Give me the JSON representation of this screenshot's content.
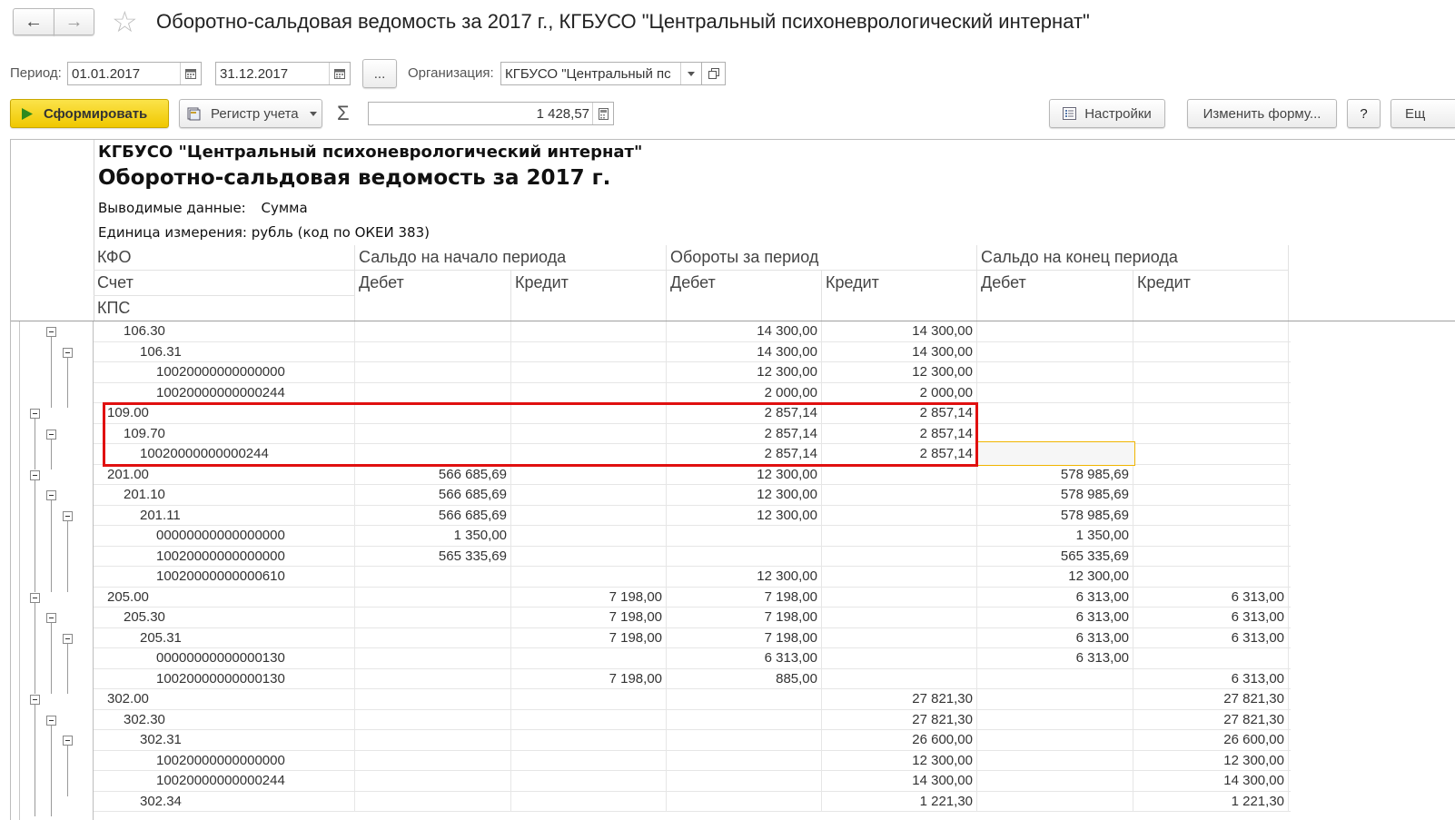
{
  "window": {
    "title": "Оборотно-сальдовая ведомость за 2017 г., КГБУСО \"Центральный психоневрологический интернат\""
  },
  "filters": {
    "period_label": "Период:",
    "date_from": "01.01.2017",
    "date_to": "31.12.2017",
    "more_label": "...",
    "org_label": "Организация:",
    "org_value": "КГБУСО \"Центральный пс"
  },
  "toolbar": {
    "generate_label": "Сформировать",
    "register_label": "Регистр учета",
    "sum_value": "1 428,57",
    "settings_label": "Настройки",
    "change_form_label": "Изменить форму...",
    "help_label": "?",
    "more_label": "Ещ"
  },
  "report": {
    "org_title": "КГБУСО \"Центральный психоневрологический интернат\"",
    "title": "Оборотно-сальдовая ведомость за 2017 г.",
    "output_label": "Выводимые данные:",
    "output_value": "Сумма",
    "unit_line": "Единица измерения: рубль (код по ОКЕИ 383)",
    "col_kfo": "КФО",
    "col_account": "Счет",
    "col_kps": "КПС",
    "group_start": "Сальдо на начало периода",
    "group_turnover": "Обороты за период",
    "group_end": "Сальдо на конец периода",
    "debit": "Дебет",
    "credit": "Кредит",
    "rows": [
      {
        "label": "106.30",
        "level": 1,
        "sd": "",
        "sc": "",
        "td": "14 300,00",
        "tc": "14 300,00",
        "ed": "",
        "ec": ""
      },
      {
        "label": "106.31",
        "level": 2,
        "sd": "",
        "sc": "",
        "td": "14 300,00",
        "tc": "14 300,00",
        "ed": "",
        "ec": ""
      },
      {
        "label": "10020000000000000",
        "level": 3,
        "sd": "",
        "sc": "",
        "td": "12 300,00",
        "tc": "12 300,00",
        "ed": "",
        "ec": ""
      },
      {
        "label": "10020000000000244",
        "level": 3,
        "sd": "",
        "sc": "",
        "td": "2 000,00",
        "tc": "2 000,00",
        "ed": "",
        "ec": ""
      },
      {
        "label": "109.00",
        "level": 0,
        "sd": "",
        "sc": "",
        "td": "2 857,14",
        "tc": "2 857,14",
        "ed": "",
        "ec": ""
      },
      {
        "label": "109.70",
        "level": 1,
        "sd": "",
        "sc": "",
        "td": "2 857,14",
        "tc": "2 857,14",
        "ed": "",
        "ec": ""
      },
      {
        "label": "10020000000000244",
        "level": 2,
        "sd": "",
        "sc": "",
        "td": "2 857,14",
        "tc": "2 857,14",
        "ed": "",
        "ec": ""
      },
      {
        "label": "201.00",
        "level": 0,
        "sd": "566 685,69",
        "sc": "",
        "td": "12 300,00",
        "tc": "",
        "ed": "578 985,69",
        "ec": ""
      },
      {
        "label": "201.10",
        "level": 1,
        "sd": "566 685,69",
        "sc": "",
        "td": "12 300,00",
        "tc": "",
        "ed": "578 985,69",
        "ec": ""
      },
      {
        "label": "201.11",
        "level": 2,
        "sd": "566 685,69",
        "sc": "",
        "td": "12 300,00",
        "tc": "",
        "ed": "578 985,69",
        "ec": ""
      },
      {
        "label": "00000000000000000",
        "level": 3,
        "sd": "1 350,00",
        "sc": "",
        "td": "",
        "tc": "",
        "ed": "1 350,00",
        "ec": ""
      },
      {
        "label": "10020000000000000",
        "level": 3,
        "sd": "565 335,69",
        "sc": "",
        "td": "",
        "tc": "",
        "ed": "565 335,69",
        "ec": ""
      },
      {
        "label": "10020000000000610",
        "level": 3,
        "sd": "",
        "sc": "",
        "td": "12 300,00",
        "tc": "",
        "ed": "12 300,00",
        "ec": ""
      },
      {
        "label": "205.00",
        "level": 0,
        "sd": "",
        "sc": "7 198,00",
        "td": "7 198,00",
        "tc": "",
        "ed": "6 313,00",
        "ec": "6 313,00"
      },
      {
        "label": "205.30",
        "level": 1,
        "sd": "",
        "sc": "7 198,00",
        "td": "7 198,00",
        "tc": "",
        "ed": "6 313,00",
        "ec": "6 313,00"
      },
      {
        "label": "205.31",
        "level": 2,
        "sd": "",
        "sc": "7 198,00",
        "td": "7 198,00",
        "tc": "",
        "ed": "6 313,00",
        "ec": "6 313,00"
      },
      {
        "label": "00000000000000130",
        "level": 3,
        "sd": "",
        "sc": "",
        "td": "6 313,00",
        "tc": "",
        "ed": "6 313,00",
        "ec": ""
      },
      {
        "label": "10020000000000130",
        "level": 3,
        "sd": "",
        "sc": "7 198,00",
        "td": "885,00",
        "tc": "",
        "ed": "",
        "ec": "6 313,00"
      },
      {
        "label": "302.00",
        "level": 0,
        "sd": "",
        "sc": "",
        "td": "",
        "tc": "27 821,30",
        "ed": "",
        "ec": "27 821,30"
      },
      {
        "label": "302.30",
        "level": 1,
        "sd": "",
        "sc": "",
        "td": "",
        "tc": "27 821,30",
        "ed": "",
        "ec": "27 821,30"
      },
      {
        "label": "302.31",
        "level": 2,
        "sd": "",
        "sc": "",
        "td": "",
        "tc": "26 600,00",
        "ed": "",
        "ec": "26 600,00"
      },
      {
        "label": "10020000000000000",
        "level": 3,
        "sd": "",
        "sc": "",
        "td": "",
        "tc": "12 300,00",
        "ed": "",
        "ec": "12 300,00"
      },
      {
        "label": "10020000000000244",
        "level": 3,
        "sd": "",
        "sc": "",
        "td": "",
        "tc": "14 300,00",
        "ed": "",
        "ec": "14 300,00"
      },
      {
        "label": "302.34",
        "level": 2,
        "sd": "",
        "sc": "",
        "td": "",
        "tc": "1 221,30",
        "ed": "",
        "ec": "1 221,30"
      }
    ]
  },
  "colors": {
    "generate_button": "#f5d40a",
    "highlight_frame": "#e01010",
    "selected_cell": "#f0b400"
  }
}
